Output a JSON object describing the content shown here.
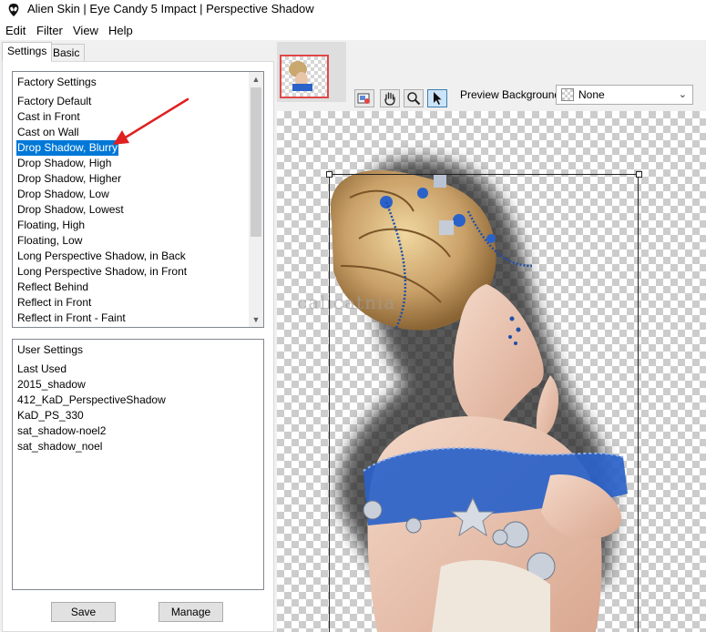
{
  "window": {
    "title": "Alien Skin | Eye Candy 5 Impact | Perspective Shadow",
    "icon": "alien-skin-icon"
  },
  "menu": {
    "items": [
      "Edit",
      "Filter",
      "View",
      "Help"
    ]
  },
  "tabs": {
    "settings": "Settings",
    "basic": "Basic"
  },
  "factory_settings": {
    "header": "Factory Settings",
    "items": [
      "Factory Default",
      "Cast in Front",
      "Cast on Wall",
      "Drop Shadow, Blurry",
      "Drop Shadow, High",
      "Drop Shadow, Higher",
      "Drop Shadow, Low",
      "Drop Shadow, Lowest",
      "Floating, High",
      "Floating, Low",
      "Long Perspective Shadow, in Back",
      "Long Perspective Shadow, in Front",
      "Reflect Behind",
      "Reflect in Front",
      "Reflect in Front - Faint"
    ],
    "selected": "Drop Shadow, Blurry"
  },
  "user_settings": {
    "header": "User Settings",
    "items": [
      "Last Used",
      "2015_shadow",
      "412_KaD_PerspectiveShadow",
      "KaD_PS_330",
      "sat_shadow-noel2",
      "sat_shadow_noel"
    ]
  },
  "buttons": {
    "save": "Save",
    "manage": "Manage"
  },
  "preview_toolbar": {
    "tools": [
      "navigate-icon",
      "hand-icon",
      "zoom-icon",
      "arrow-icon"
    ],
    "active_tool": "arrow-icon",
    "background_label": "Preview Background:",
    "background_value": "None"
  },
  "watermark": "calicatnia",
  "colors": {
    "selection": "#0078d7",
    "annotation_arrow": "#e02020",
    "thumbnail_border": "#e04848",
    "accent_blue": "#1f5fbf"
  }
}
